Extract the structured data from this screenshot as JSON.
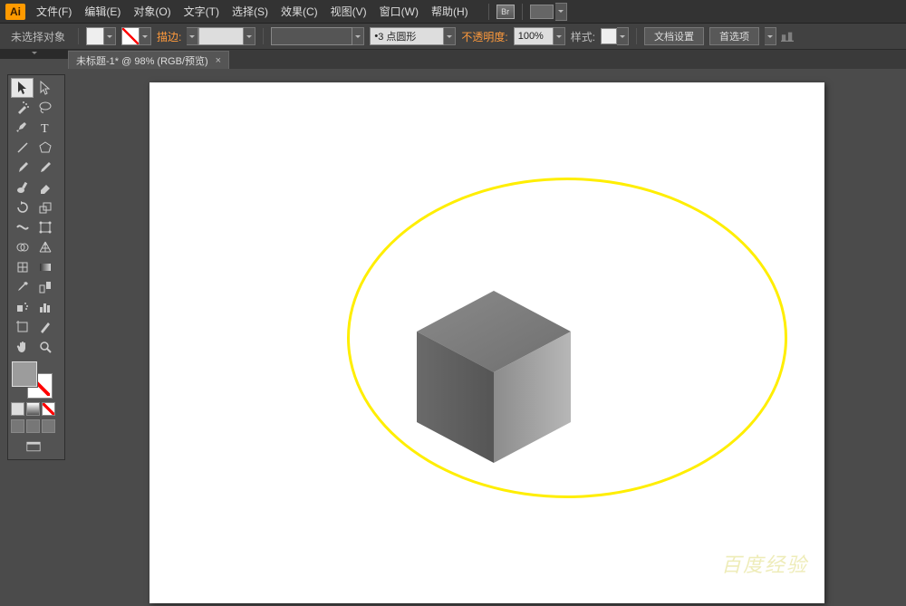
{
  "menubar": {
    "logo": "Ai",
    "items": [
      "文件(F)",
      "编辑(E)",
      "对象(O)",
      "文字(T)",
      "选择(S)",
      "效果(C)",
      "视图(V)",
      "窗口(W)",
      "帮助(H)"
    ],
    "br_label": "Br"
  },
  "controlbar": {
    "selection": "未选择对象",
    "stroke_label": "描边:",
    "stroke_width": "",
    "brush_value": "",
    "style_value": "3 点圆形",
    "opacity_label": "不透明度:",
    "opacity_value": "100%",
    "graphic_style_label": "样式:",
    "doc_setup": "文档设置",
    "prefs": "首选项"
  },
  "tab": {
    "title": "未标题-1* @ 98% (RGB/预览)",
    "close": "×"
  },
  "watermark": "百度经验"
}
